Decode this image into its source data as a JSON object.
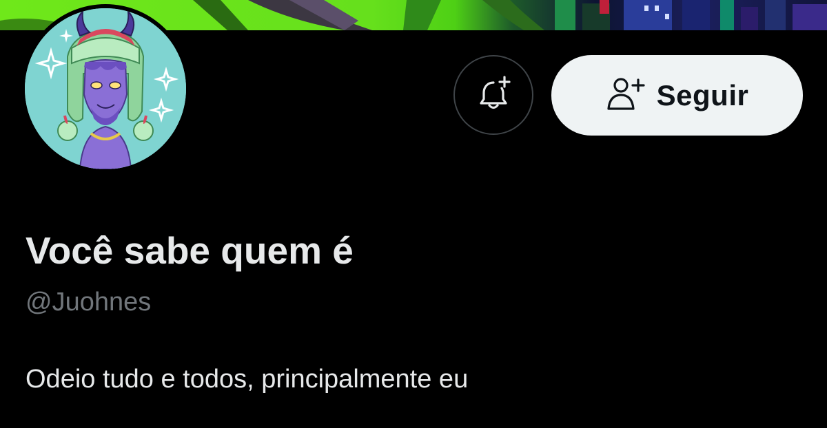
{
  "banner": {
    "colors": [
      "#6fe81a",
      "#1d5a2a",
      "#1b1f5c"
    ]
  },
  "avatar": {
    "background_color": "#7fd4d1"
  },
  "actions": {
    "notify_icon": "bell-plus-icon",
    "follow_icon": "user-plus-icon",
    "follow_label": "Seguir",
    "follow_bg": "#eff3f4"
  },
  "profile": {
    "display_name": "Você sabe quem é",
    "handle": "@Juohnes",
    "bio": "Odeio tudo e todos, principalmente eu"
  },
  "theme": {
    "background": "#000000",
    "text_primary": "#e7e9ea",
    "text_secondary": "#71767b"
  }
}
